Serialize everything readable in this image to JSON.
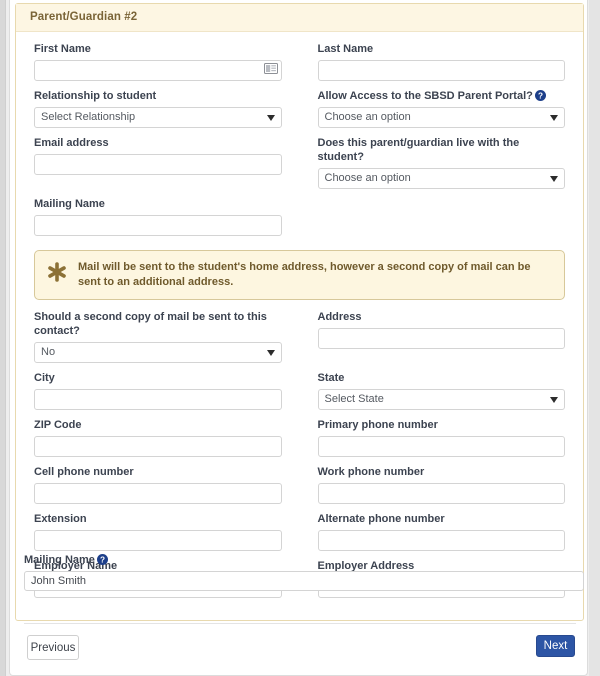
{
  "panel": {
    "title": "Parent/Guardian #2",
    "fields": [
      {
        "name": "first-name",
        "label": "First Name",
        "type": "text",
        "value": "",
        "placeholder": "",
        "icon": "contact-card-icon"
      },
      {
        "name": "last-name",
        "label": "Last Name",
        "type": "text",
        "value": "",
        "placeholder": ""
      },
      {
        "name": "relationship-to-student",
        "label": "Relationship to student",
        "type": "select",
        "value": "Select Relationship"
      },
      {
        "name": "allow-access-parent-portal",
        "label": "Allow Access to the SBSD Parent Portal?",
        "type": "select",
        "value": "Choose an option",
        "help": true
      },
      {
        "name": "email-address",
        "label": "Email address",
        "type": "text",
        "value": "",
        "placeholder": ""
      },
      {
        "name": "lives-with-student",
        "label": "Does this parent/guardian live with the student?",
        "type": "select",
        "value": "Choose an option"
      },
      {
        "name": "mailing-name",
        "label": "Mailing Name",
        "type": "text",
        "value": "",
        "placeholder": ""
      }
    ],
    "alert": {
      "icon": "asterisk-icon",
      "message": "Mail will be sent to the student's home address, however a second copy of mail can be sent to an additional address."
    },
    "fields2": [
      {
        "name": "second-copy-of-mail",
        "label": "Should a second copy of mail be sent to this contact?",
        "type": "select",
        "value": "No"
      },
      {
        "name": "address",
        "label": "Address",
        "type": "text",
        "value": "",
        "placeholder": ""
      },
      {
        "name": "city",
        "label": "City",
        "type": "text",
        "value": "",
        "placeholder": ""
      },
      {
        "name": "state",
        "label": "State",
        "type": "select",
        "value": "Select State"
      },
      {
        "name": "zip-code",
        "label": "ZIP Code",
        "type": "text",
        "value": "",
        "placeholder": ""
      },
      {
        "name": "primary-phone-number",
        "label": "Primary phone number",
        "type": "text",
        "value": "",
        "placeholder": ""
      },
      {
        "name": "cell-phone-number",
        "label": "Cell phone number",
        "type": "text",
        "value": "",
        "placeholder": ""
      },
      {
        "name": "work-phone-number",
        "label": "Work phone number",
        "type": "text",
        "value": "",
        "placeholder": ""
      },
      {
        "name": "extension",
        "label": "Extension",
        "type": "text",
        "value": "",
        "placeholder": ""
      },
      {
        "name": "alternate-phone-number",
        "label": "Alternate phone number",
        "type": "text",
        "value": "",
        "placeholder": ""
      },
      {
        "name": "employer-name",
        "label": "Employer Name",
        "type": "text",
        "value": "",
        "placeholder": ""
      },
      {
        "name": "employer-address",
        "label": "Employer Address",
        "type": "text",
        "value": "",
        "placeholder": ""
      }
    ]
  },
  "bottom_field": {
    "label": "Mailing Name",
    "value": "John Smith",
    "help": true
  },
  "footer": {
    "previous_label": "Previous",
    "next_label": "Next"
  },
  "colors": {
    "panel_header_bg": "#fdf6e3",
    "panel_header_text": "#7a6437",
    "panel_border": "#e8d9ae",
    "alert_bg": "#fdf6e0",
    "alert_border": "#d7c89a",
    "alert_text": "#6f5a2c",
    "asterisk": "#8c7136",
    "help_icon": "#1d3f8a",
    "next_button_bg": "#2d55a5",
    "label_text": "#3c4350",
    "input_border": "#d4d4d4"
  }
}
